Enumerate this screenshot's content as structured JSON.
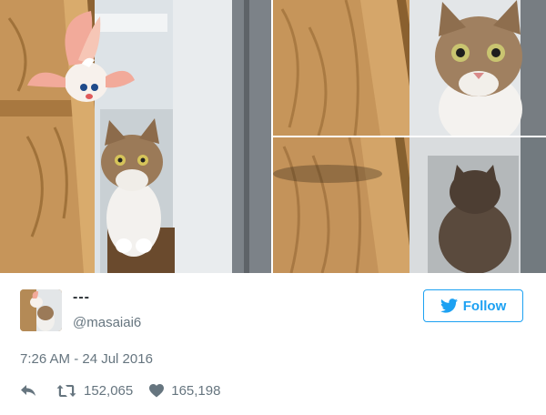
{
  "tweet": {
    "display_name": "---",
    "handle": "@masaiai6",
    "timestamp": "7:26 AM - 24 Jul 2016",
    "follow_label": "Follow",
    "retweet_count": "152,065",
    "like_count": "165,198"
  },
  "icons": {
    "follow": "twitter-bird-icon",
    "reply": "reply-arrow-icon",
    "retweet": "retweet-icon",
    "like": "heart-icon"
  },
  "colors": {
    "accent": "#1da1f2",
    "secondary_text": "#66757f",
    "primary_text": "#292f33"
  }
}
